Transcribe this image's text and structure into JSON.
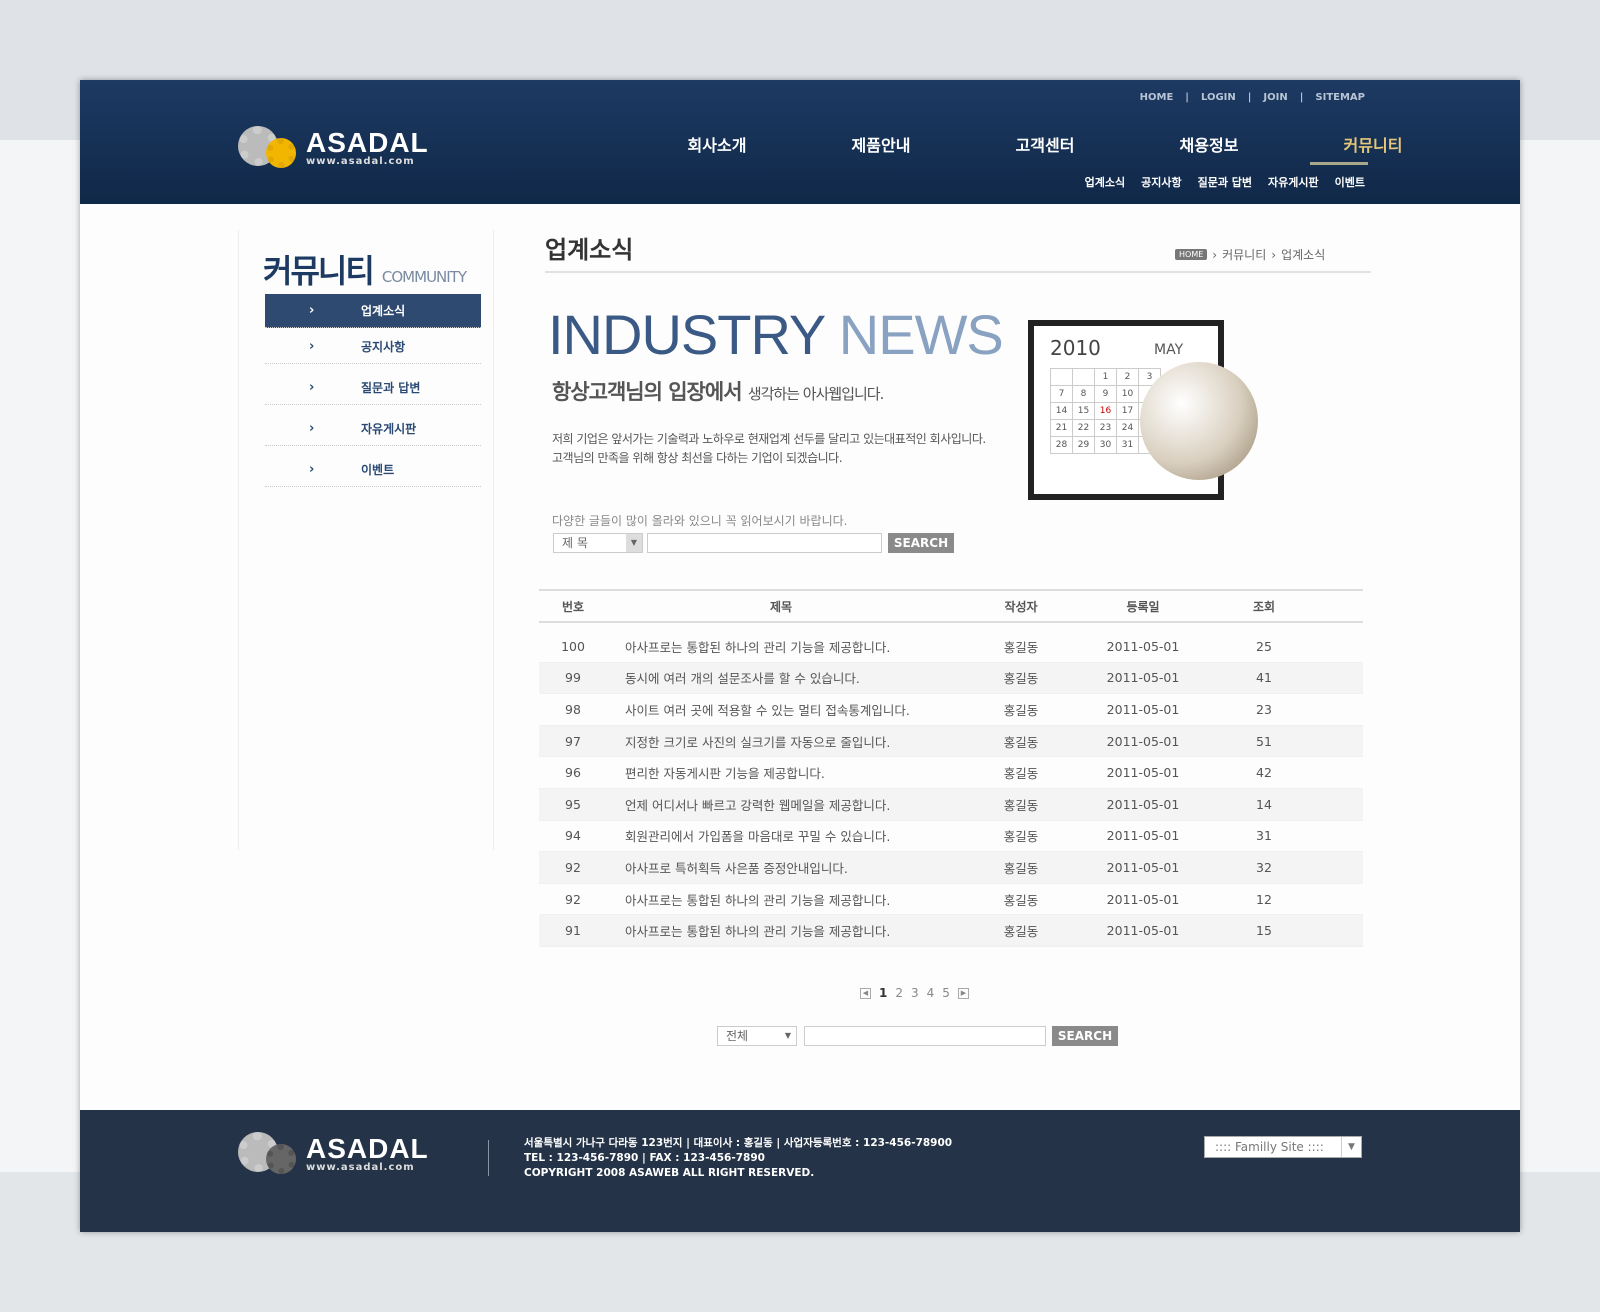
{
  "brand": {
    "name": "ASADAL",
    "url": "www.asadal.com"
  },
  "util_links": [
    "HOME",
    "LOGIN",
    "JOIN",
    "SITEMAP"
  ],
  "main_nav": [
    "회사소개",
    "제품안내",
    "고객센터",
    "채용정보",
    "커뮤니티"
  ],
  "sub_nav": [
    "업계소식",
    "공지사항",
    "질문과 답변",
    "자유게시판",
    "이벤트"
  ],
  "sidebar": {
    "title": "커뮤니티",
    "title_en": "COMMUNITY",
    "items": [
      {
        "label": "업계소식",
        "active": true
      },
      {
        "label": "공지사항"
      },
      {
        "label": "질문과 답변"
      },
      {
        "label": "자유게시판"
      },
      {
        "label": "이벤트"
      }
    ]
  },
  "content": {
    "title": "업계소식",
    "breadcrumb": [
      "HOME",
      "커뮤니티",
      "업계소식"
    ]
  },
  "hero": {
    "title_a": "INDUSTRY",
    "title_b": "NEWS",
    "subtitle_a": "항상고객님의 입장에서",
    "subtitle_b": "생각하는 아사웹입니다.",
    "desc1": "저희 기업은 앞서가는 기술력과 노하우로 현재업계 선두를 달리고 있는대표적인 회사입니다.",
    "desc2": "고객님의 만족을 위해 항상 최선을 다하는 기업이 되겠습니다.",
    "cal_year": "2010",
    "cal_month": "MAY"
  },
  "search_top": {
    "hint": "다양한 글들이 많이 올라와 있으니 꼭 읽어보시기 바랍니다.",
    "select": "제 목",
    "button": "SEARCH"
  },
  "table": {
    "headers": [
      "번호",
      "제목",
      "작성자",
      "등록일",
      "조회"
    ],
    "rows": [
      [
        "100",
        "아사프로는 통합된 하나의 관리 기능을 제공합니다.",
        "홍길동",
        "2011-05-01",
        "25"
      ],
      [
        "99",
        "동시에 여러 개의 설문조사를 할 수 있습니다.",
        "홍길동",
        "2011-05-01",
        "41"
      ],
      [
        "98",
        "사이트 여러 곳에 적용할 수 있는 멀티 접속통계입니다.",
        "홍길동",
        "2011-05-01",
        "23"
      ],
      [
        "97",
        "지정한 크기로 사진의 실크기를 자동으로 줄입니다.",
        "홍길동",
        "2011-05-01",
        "51"
      ],
      [
        "96",
        "편리한 자동게시판 기능을 제공합니다.",
        "홍길동",
        "2011-05-01",
        "42"
      ],
      [
        "95",
        "언제 어디서나 빠르고 강력한 웹메일을 제공합니다.",
        "홍길동",
        "2011-05-01",
        "14"
      ],
      [
        "94",
        "회원관리에서 가입폼을 마음대로 꾸밀 수 있습니다.",
        "홍길동",
        "2011-05-01",
        "31"
      ],
      [
        "92",
        "아사프로 특허획득 사은품 증정안내입니다.",
        "홍길동",
        "2011-05-01",
        "32"
      ],
      [
        "92",
        "아사프로는 통합된 하나의 관리 기능을 제공합니다.",
        "홍길동",
        "2011-05-01",
        "12"
      ],
      [
        "91",
        "아사프로는 통합된 하나의 관리 기능을 제공합니다.",
        "홍길동",
        "2011-05-01",
        "15"
      ]
    ]
  },
  "pagination": {
    "pages": [
      "1",
      "2",
      "3",
      "4",
      "5"
    ],
    "current": "1"
  },
  "search_bottom": {
    "select": "전체",
    "button": "SEARCH"
  },
  "footer": {
    "line1": "서울특별시 가나구 다라동 123번지  |  대표이사 : 홍길동  |  사업자등록번호 : 123-456-78900",
    "line2": "TEL : 123-456-7890  |  FAX : 123-456-7890",
    "line3": "COPYRIGHT 2008 ASAWEB ALL RIGHT RESERVED.",
    "family_site": ":::: Familly Site ::::"
  }
}
